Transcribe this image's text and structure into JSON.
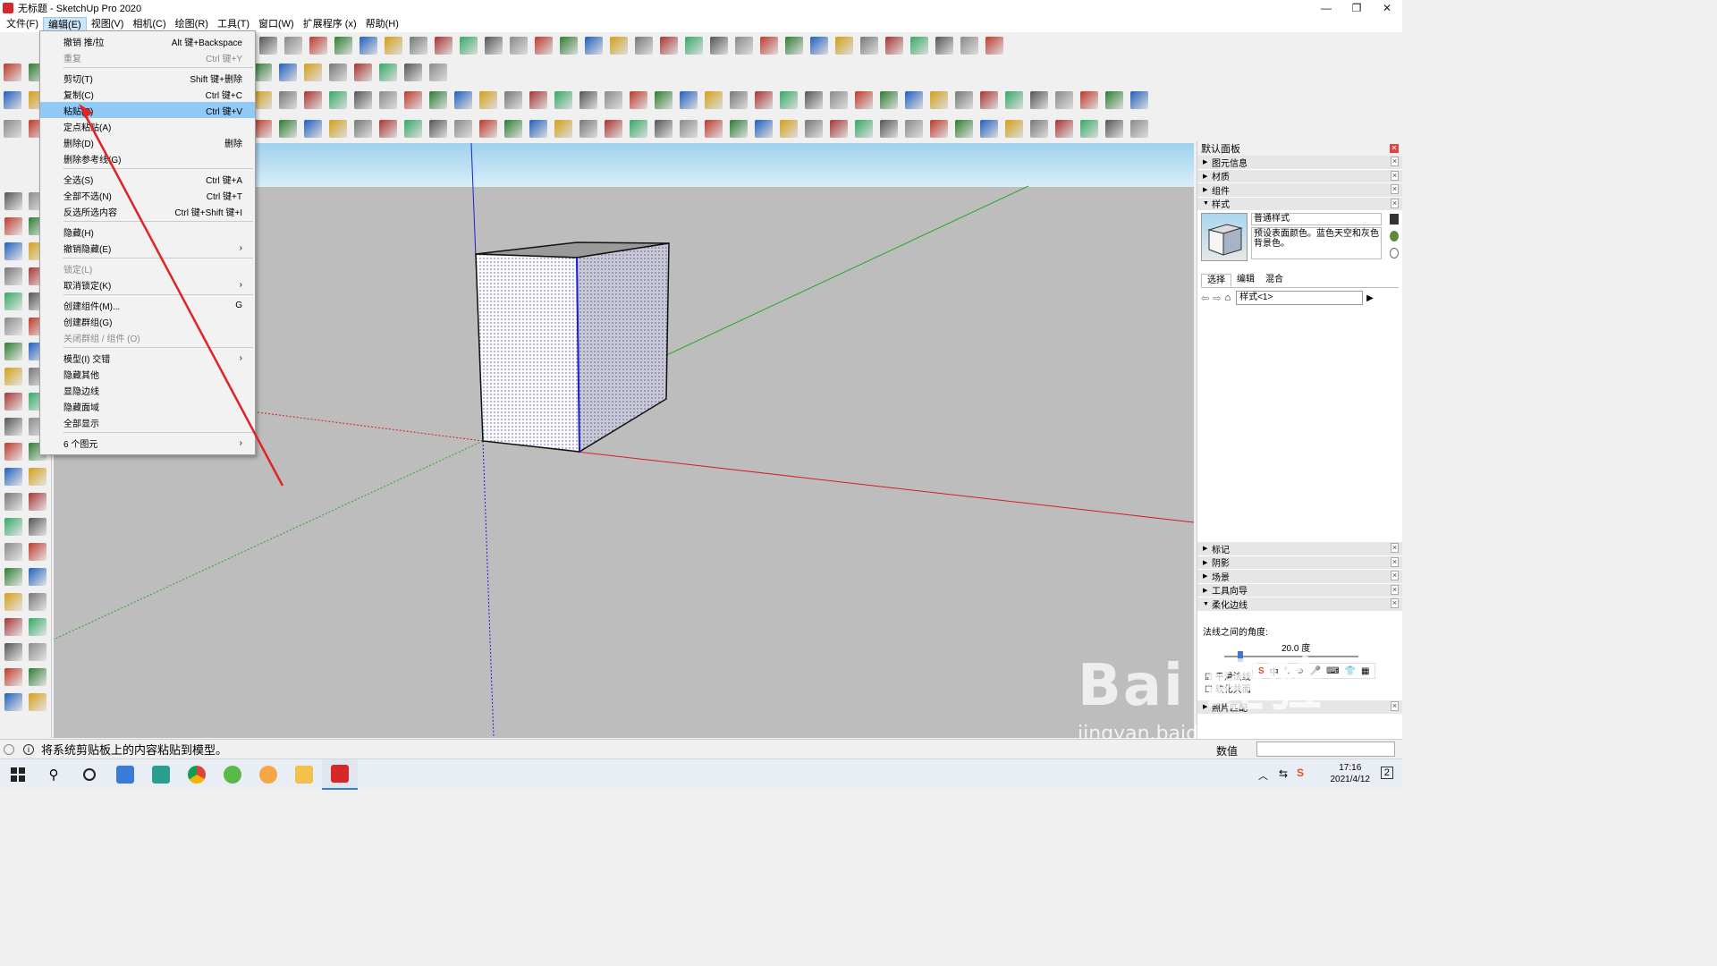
{
  "window": {
    "title": "无标题 - SketchUp Pro 2020",
    "controls": [
      "—",
      "❐",
      "✕"
    ]
  },
  "menubar": {
    "items": [
      "文件(F)",
      "编辑(E)",
      "视图(V)",
      "相机(C)",
      "绘图(R)",
      "工具(T)",
      "窗口(W)",
      "扩展程序 (x)",
      "帮助(H)"
    ],
    "active": "编辑(E)"
  },
  "edit_menu": {
    "items": [
      {
        "label": "撤销 推/拉",
        "shortcut": "Alt 键+Backspace",
        "disabled": false
      },
      {
        "label": "重复",
        "shortcut": "Ctrl 键+Y",
        "disabled": true
      },
      {
        "sep": true
      },
      {
        "label": "剪切(T)",
        "shortcut": "Shift 键+删除",
        "disabled": false
      },
      {
        "label": "复制(C)",
        "shortcut": "Ctrl 键+C",
        "disabled": false
      },
      {
        "label": "粘贴(P)",
        "shortcut": "Ctrl 键+V",
        "disabled": false,
        "highlighted": true
      },
      {
        "label": "定点粘贴(A)",
        "shortcut": "",
        "disabled": false
      },
      {
        "label": "删除(D)",
        "shortcut": "删除",
        "disabled": false
      },
      {
        "label": "删除参考线(G)",
        "shortcut": "",
        "disabled": false
      },
      {
        "sep": true
      },
      {
        "label": "全选(S)",
        "shortcut": "Ctrl 键+A",
        "disabled": false
      },
      {
        "label": "全部不选(N)",
        "shortcut": "Ctrl 键+T",
        "disabled": false
      },
      {
        "label": "反选所选内容",
        "shortcut": "Ctrl 键+Shift 键+I",
        "disabled": false
      },
      {
        "sep": true
      },
      {
        "label": "隐藏(H)",
        "shortcut": "",
        "disabled": false
      },
      {
        "label": "撤销隐藏(E)",
        "shortcut": "›",
        "disabled": false
      },
      {
        "sep": true
      },
      {
        "label": "锁定(L)",
        "shortcut": "",
        "disabled": true
      },
      {
        "label": "取消锁定(K)",
        "shortcut": "›",
        "disabled": false
      },
      {
        "sep": true
      },
      {
        "label": "创建组件(M)...",
        "shortcut": "G",
        "disabled": false
      },
      {
        "label": "创建群组(G)",
        "shortcut": "",
        "disabled": false
      },
      {
        "label": "关闭群组 / 组件 (O)",
        "shortcut": "",
        "disabled": true
      },
      {
        "sep": true
      },
      {
        "label": "模型(I) 交错",
        "shortcut": "›",
        "disabled": false
      },
      {
        "label": "隐藏其他",
        "shortcut": "",
        "disabled": false
      },
      {
        "label": "显隐边线",
        "shortcut": "",
        "disabled": false
      },
      {
        "label": "隐藏面域",
        "shortcut": "",
        "disabled": false
      },
      {
        "label": "全部显示",
        "shortcut": "",
        "disabled": false
      },
      {
        "sep": true
      },
      {
        "label": "6 个图元",
        "shortcut": "›",
        "disabled": false
      }
    ]
  },
  "tray": {
    "title": "默认面板",
    "sections_top": [
      "图元信息",
      "材质",
      "组件"
    ],
    "styles": {
      "section": "样式",
      "name": "普通样式",
      "description": "预设表面颜色。蓝色天空和灰色背景色。",
      "tabs": [
        "选择",
        "编辑",
        "混合"
      ],
      "selected_tab": "选择",
      "dropdown": "样式<1>"
    },
    "sections_bottom": [
      "标记",
      "阴影",
      "场景",
      "工具向导"
    ],
    "soften": {
      "section": "柔化边线",
      "angle_label": "法线之间的角度:",
      "angle_value": "20.0  度",
      "slider_fraction": 0.1,
      "check1": "平滑法线",
      "check2": "软化共面"
    },
    "last_section": "照片匹配"
  },
  "status": {
    "message": "将系统剪贴板上的内容粘贴到模型。",
    "measure_label": "数值"
  },
  "taskbar": {
    "time": "17:16",
    "date": "2021/4/12",
    "notify": "2"
  },
  "watermark": {
    "logo": "Bai 经验",
    "url": "jingyan.baidu.com"
  },
  "ime": {
    "items": [
      "中",
      "°,",
      "☺",
      "🎤",
      "⌨",
      "👕",
      "▦"
    ]
  },
  "colors": {
    "accent": "#91c9f7",
    "axis_red": "#d42020",
    "axis_green": "#2aa52a",
    "axis_blue": "#1f1fd6",
    "sky": "#a8d8f0",
    "ground": "#bdbdbd",
    "arrow": "#e02424"
  }
}
